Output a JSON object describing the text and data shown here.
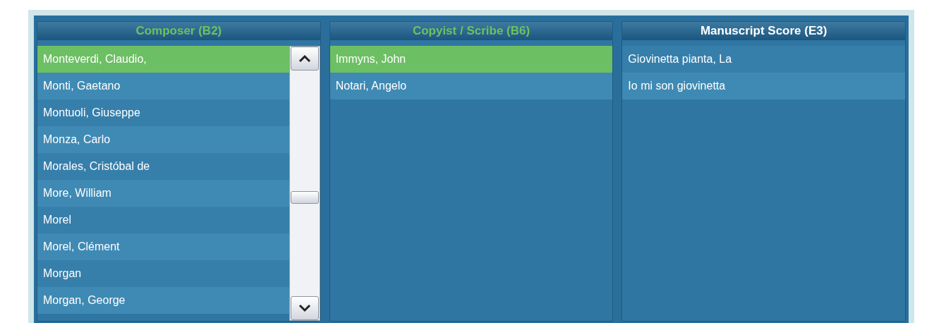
{
  "columns": [
    {
      "title": "Composer (B2)",
      "active": true,
      "scrollbar": true,
      "items": [
        {
          "label": "Monteverdi, Claudio,",
          "selected": true
        },
        {
          "label": "Monti, Gaetano",
          "selected": false
        },
        {
          "label": "Montuoli, Giuseppe",
          "selected": false
        },
        {
          "label": "Monza, Carlo",
          "selected": false
        },
        {
          "label": "Morales, Cristóbal de",
          "selected": false
        },
        {
          "label": "More, William",
          "selected": false
        },
        {
          "label": "Morel",
          "selected": false
        },
        {
          "label": "Morel, Clément",
          "selected": false
        },
        {
          "label": "Morgan",
          "selected": false
        },
        {
          "label": "Morgan, George",
          "selected": false
        }
      ]
    },
    {
      "title": "Copyist / Scribe (B6)",
      "active": true,
      "scrollbar": false,
      "items": [
        {
          "label": "Immyns, John",
          "selected": true
        },
        {
          "label": "Notari, Angelo",
          "selected": false
        }
      ]
    },
    {
      "title": "Manuscript Score (E3)",
      "active": false,
      "scrollbar": false,
      "items": [
        {
          "label": "Giovinetta pianta, La",
          "selected": false
        },
        {
          "label": "Io mi son giovinetta",
          "selected": false
        }
      ]
    }
  ]
}
